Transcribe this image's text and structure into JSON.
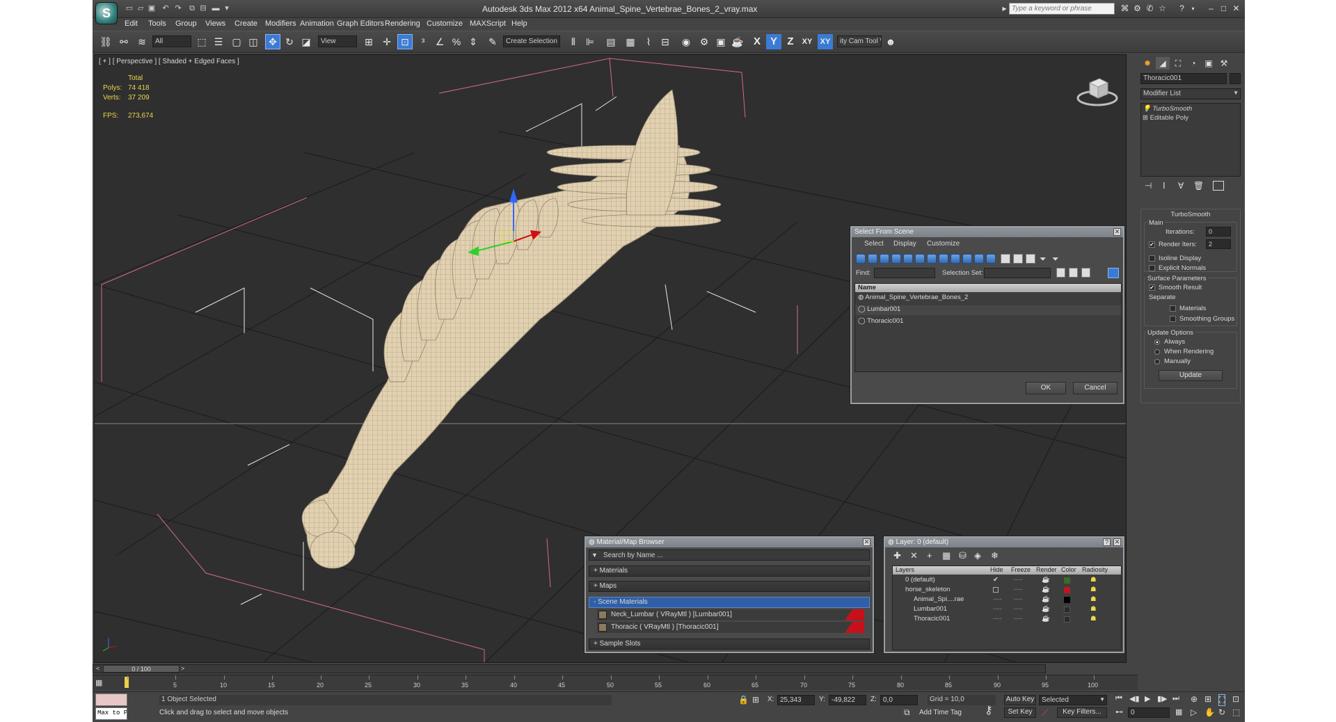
{
  "app": {
    "window_title": "Autodesk 3ds Max  2012 x64     Animal_Spine_Vertebrae_Bones_2_vray.max",
    "search_placeholder": "Type a keyword or phrase",
    "logo_glyph": "S"
  },
  "menubar": [
    "Edit",
    "Tools",
    "Group",
    "Views",
    "Create",
    "Modifiers",
    "Animation",
    "Graph Editors",
    "Rendering",
    "Customize",
    "MAXScript",
    "Help"
  ],
  "toolbar": {
    "selection_filter": "All",
    "ref_coord": "View",
    "create_selection_set": "Create Selection Se",
    "axis_buttons": [
      "X",
      "Y",
      "Z",
      "XY",
      "XY"
    ],
    "cam_tool": "ity Cam Tool \\"
  },
  "viewport": {
    "label": "[ + ] [ Perspective ] [ Shaded + Edged Faces ]",
    "stats": {
      "total_label": "Total",
      "polys_label": "Polys:",
      "polys": "74 418",
      "verts_label": "Verts:",
      "verts": "37 209",
      "fps_label": "FPS:",
      "fps": "273,674"
    }
  },
  "command_panel": {
    "object_name": "Thoracic001",
    "modifier_list": "Modifier List",
    "stack": [
      "TurboSmooth",
      "Editable Poly"
    ],
    "turbosmooth": {
      "title": "TurboSmooth",
      "main_label": "Main",
      "iterations_label": "Iterations:",
      "iterations": "0",
      "render_iters_label": "Render Iters:",
      "render_iters": "2",
      "isoline_label": "Isoline Display",
      "explicit_label": "Explicit Normals",
      "surface_label": "Surface Parameters",
      "smooth_result_label": "Smooth Result",
      "separate_label": "Separate",
      "materials_label": "Materials",
      "smoothing_groups_label": "Smoothing Groups",
      "update_options_label": "Update Options",
      "always_label": "Always",
      "when_rendering_label": "When Rendering",
      "manually_label": "Manually",
      "update_button": "Update"
    }
  },
  "select_from_scene": {
    "title": "Select From Scene",
    "menus": [
      "Select",
      "Display",
      "Customize"
    ],
    "find_label": "Find:",
    "selection_set_label": "Selection Set:",
    "column_name": "Name",
    "items": [
      "Animal_Spine_Vertebrae_Bones_2",
      "Lumbar001",
      "Thoracic001"
    ],
    "ok": "OK",
    "cancel": "Cancel"
  },
  "material_browser": {
    "title": "Material/Map Browser",
    "search_placeholder": "Search by Name ...",
    "sections": [
      "+ Materials",
      "+ Maps",
      "- Scene Materials",
      "+ Sample Slots"
    ],
    "materials": [
      "Neck_Lumbar  ( VRayMtl ) [Lumbar001]",
      "Thoracic  ( VRayMtl ) [Thoracic001]"
    ]
  },
  "layer_manager": {
    "title": "Layer: 0 (default)",
    "columns": [
      "Layers",
      "Hide",
      "Freeze",
      "Render",
      "Color",
      "Radiosity"
    ],
    "rows": [
      {
        "name": "0 (default)",
        "color": "#3a6b2a"
      },
      {
        "name": "horse_skeleton",
        "color": "#c01525"
      },
      {
        "name": "Animal_Spi....rae",
        "color": "#000000"
      },
      {
        "name": "Lumbar001",
        "color": "#2a2a2a"
      },
      {
        "name": "Thoracic001",
        "color": "#2a2a2a"
      }
    ],
    "dashes": "----",
    "help": "?"
  },
  "timeline": {
    "frame_readout": "0 / 100",
    "ticks": [
      "5",
      "10",
      "15",
      "20",
      "25",
      "30",
      "35",
      "40",
      "45",
      "50",
      "55",
      "60",
      "65",
      "70",
      "75",
      "80",
      "85",
      "90",
      "95",
      "100"
    ]
  },
  "statusbar": {
    "script_label": "Max to Physc",
    "selected_text": "1 Object Selected",
    "prompt": "Click and drag to select and move objects",
    "x_label": "X:",
    "x_value": "25,343",
    "y_label": "Y:",
    "y_value": "-49,822",
    "z_label": "Z:",
    "z_value": "0,0",
    "grid": "Grid = 10,0",
    "add_time_tag": "Add Time Tag",
    "auto_key": "Auto Key",
    "set_key": "Set Key",
    "selected_dropdown": "Selected",
    "key_filters": "Key Filters...",
    "frame_field": "0"
  },
  "colors": {
    "accent": "#3b7bd6",
    "mesh": "#e4d3b3",
    "grid": "#1d1d1d",
    "highlight_row": "#2f5fa8"
  }
}
